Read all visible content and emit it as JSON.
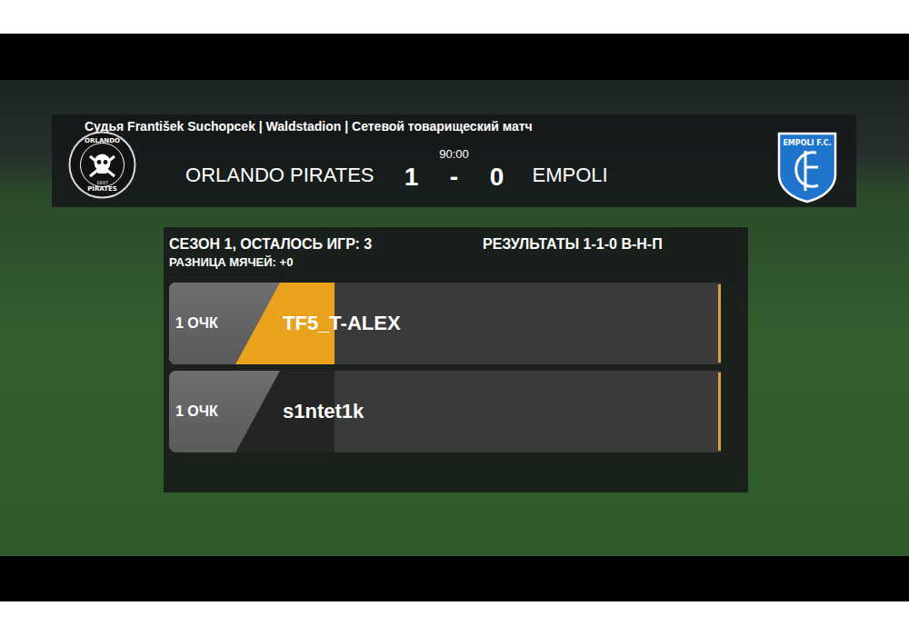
{
  "match": {
    "info": "Судья František Suchopcek | Waldstadion | Сетевой товарищеский матч",
    "clock": "90:00",
    "separator": "-",
    "home": {
      "name": "ORLANDO PIRATES",
      "score": "1",
      "logo": {
        "top": "ORLANDO",
        "bottom": "PIRATES",
        "year": "1937"
      }
    },
    "away": {
      "name": "EMPOLI",
      "score": "0",
      "logo": {
        "text": "EMPOLI F.C."
      }
    }
  },
  "season": {
    "title": "СЕЗОН 1, ОСТАЛОСЬ ИГР: 3",
    "results": "РЕЗУЛЬТАТЫ 1-1-0 В-Н-П",
    "goal_difference": "РАЗНИЦА МЯЧЕЙ: +0",
    "players": [
      {
        "points": "1 ОЧК",
        "name": "TF5_T-ALEX",
        "level": 0.3,
        "color": "#e9a21b"
      },
      {
        "points": "1 ОЧК",
        "name": "s1ntet1k",
        "level": 0.3,
        "color": "#242424"
      }
    ]
  }
}
